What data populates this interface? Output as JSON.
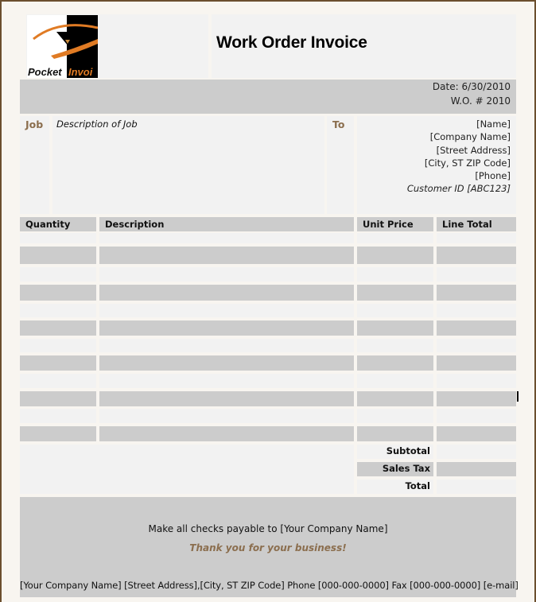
{
  "header": {
    "logo_text_left": "Pocket",
    "logo_text_right": "Invoi",
    "title": "Work Order Invoice"
  },
  "meta": {
    "date_line": "Date:  6/30/2010",
    "wo_line": "W.O. # 2010"
  },
  "job": {
    "label": "Job",
    "description": "Description of Job"
  },
  "to": {
    "label": "To",
    "name": "[Name]",
    "company": "[Company Name]",
    "street": "[Street Address]",
    "city": "[City, ST  ZIP Code]",
    "phone": "[Phone]",
    "customer_id": "Customer ID [ABC123]"
  },
  "table": {
    "columns": [
      "Quantity",
      "Description",
      "Unit Price",
      "Line Total"
    ],
    "rows": [
      [
        "",
        "",
        "",
        ""
      ],
      [
        "",
        "",
        "",
        ""
      ],
      [
        "",
        "",
        "",
        ""
      ],
      [
        "",
        "",
        "",
        ""
      ],
      [
        "",
        "",
        "",
        ""
      ],
      [
        "",
        "",
        "",
        ""
      ],
      [
        "",
        "",
        "",
        ""
      ],
      [
        "",
        "",
        "",
        ""
      ],
      [
        "",
        "",
        "",
        ""
      ],
      [
        "",
        "",
        "",
        ""
      ],
      [
        "",
        "",
        "",
        ""
      ],
      [
        "",
        "",
        "",
        ""
      ]
    ]
  },
  "totals": {
    "subtotal_label": "Subtotal",
    "subtotal_value": "",
    "tax_label": "Sales Tax",
    "tax_value": "",
    "total_label": "Total",
    "total_value": ""
  },
  "footer": {
    "payable": "Make all checks payable to [Your Company Name]",
    "thanks": "Thank you for your business!",
    "contact": "[Your Company Name]  [Street Address],[City, ST  ZIP Code]  Phone [000-000-0000]  Fax [000-000-0000]  [e-mail]"
  },
  "colors": {
    "accent_brown": "#8b6e4e",
    "logo_orange": "#e07b24",
    "cell_light": "#f2f2f2",
    "cell_gray": "#cccccc",
    "frame": "#6b4f2e"
  }
}
